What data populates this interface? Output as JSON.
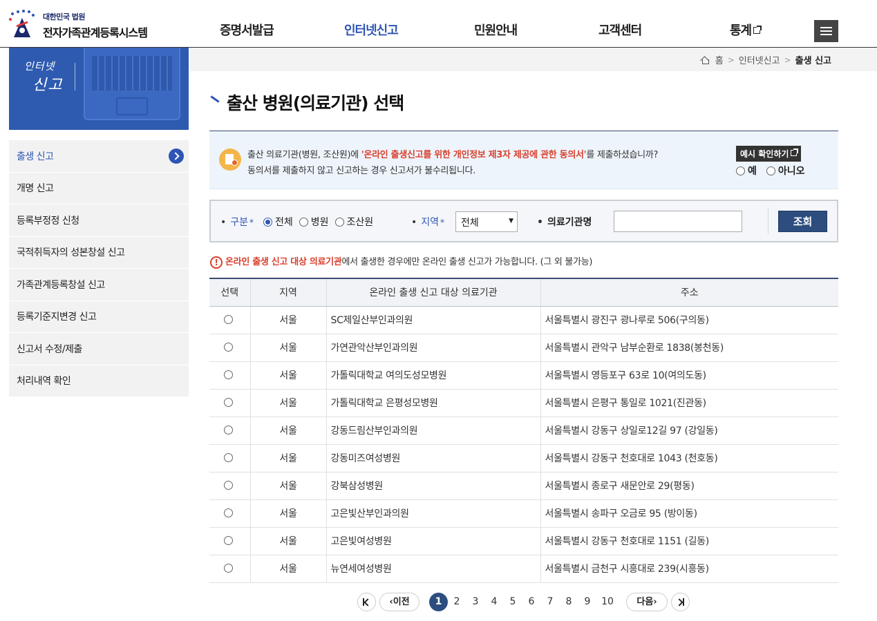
{
  "header": {
    "logo_small": "대한민국 법원",
    "logo_main": "전자가족관계등록시스템",
    "nav": [
      {
        "label": "증명서발급",
        "active": false,
        "external": false
      },
      {
        "label": "인터넷신고",
        "active": true,
        "external": false
      },
      {
        "label": "민원안내",
        "active": false,
        "external": false
      },
      {
        "label": "고객센터",
        "active": false,
        "external": false
      },
      {
        "label": "통계",
        "active": false,
        "external": true
      }
    ],
    "menu_icon": "hamburger-menu-icon"
  },
  "sidebar": {
    "banner_line1": "인터넷",
    "banner_line2": "신고",
    "items": [
      {
        "label": "출생 신고",
        "active": true
      },
      {
        "label": "개명 신고",
        "active": false
      },
      {
        "label": "등록부정정 신청",
        "active": false
      },
      {
        "label": "국적취득자의 성본창설 신고",
        "active": false
      },
      {
        "label": "가족관계등록창설 신고",
        "active": false
      },
      {
        "label": "등록기준지변경 신고",
        "active": false
      },
      {
        "label": "신고서 수정/제출",
        "active": false
      },
      {
        "label": "처리내역 확인",
        "active": false
      }
    ]
  },
  "breadcrumb": {
    "home": "홈",
    "level1": "인터넷신고",
    "current": "출생 신고"
  },
  "page_title": "출산 병원(의료기관) 선택",
  "notice": {
    "line1_pre": "출산 의료기관(병원, 조산원)에 ",
    "line1_highlight": "'온라인 출생신고를 위한 개인정보 제3자 제공에 관한 동의서'",
    "line1_post": "를 제출하셨습니까?",
    "line2": "동의서를 제출하지 않고 신고하는 경우 신고서가 불수리됩니다.",
    "example_button": "예시 확인하기",
    "yes_label": "예",
    "no_label": "아니오"
  },
  "search": {
    "type_label": "구분",
    "type_options": [
      {
        "label": "전체",
        "checked": true
      },
      {
        "label": "병원",
        "checked": false
      },
      {
        "label": "조산원",
        "checked": false
      }
    ],
    "region_label": "지역",
    "region_value": "전체",
    "name_label": "의료기관명",
    "name_value": "",
    "search_button": "조회"
  },
  "warning": {
    "highlight": "온라인 출생 신고 대상 의료기관",
    "rest": "에서 출생한 경우에만 온라인 출생 신고가 가능합니다. (그 외 불가능)"
  },
  "table": {
    "headers": [
      "선택",
      "지역",
      "온라인 출생 신고 대상 의료기관",
      "주소"
    ],
    "rows": [
      {
        "region": "서울",
        "name": "SC제일산부인과의원",
        "address": "서울특별시 광진구 광나루로 506(구의동)"
      },
      {
        "region": "서울",
        "name": "가연관악산부인과의원",
        "address": "서울특별시 관악구 남부순환로 1838(봉천동)"
      },
      {
        "region": "서울",
        "name": "가톨릭대학교 여의도성모병원",
        "address": "서울특별시 영등포구 63로 10(여의도동)"
      },
      {
        "region": "서울",
        "name": "가톨릭대학교 은평성모병원",
        "address": "서울특별시 은평구 통일로 1021(진관동)"
      },
      {
        "region": "서울",
        "name": "강동드림산부인과의원",
        "address": "서울특별시 강동구 상일로12길 97 (강일동)"
      },
      {
        "region": "서울",
        "name": "강동미즈여성병원",
        "address": "서울특별시 강동구 천호대로 1043 (천호동)"
      },
      {
        "region": "서울",
        "name": "강북삼성병원",
        "address": "서울특별시 종로구 새문안로 29(평동)"
      },
      {
        "region": "서울",
        "name": "고은빛산부인과의원",
        "address": "서울특별시 송파구 오금로 95 (방이동)"
      },
      {
        "region": "서울",
        "name": "고은빛여성병원",
        "address": "서울특별시 강동구 천호대로 1151 (길동)"
      },
      {
        "region": "서울",
        "name": "뉴연세여성병원",
        "address": "서울특별시 금천구 시흥대로 239(시흥동)"
      }
    ]
  },
  "pagination": {
    "prev_label": "이전",
    "next_label": "다음",
    "pages": [
      "1",
      "2",
      "3",
      "4",
      "5",
      "6",
      "7",
      "8",
      "9",
      "10"
    ],
    "current": "1"
  }
}
